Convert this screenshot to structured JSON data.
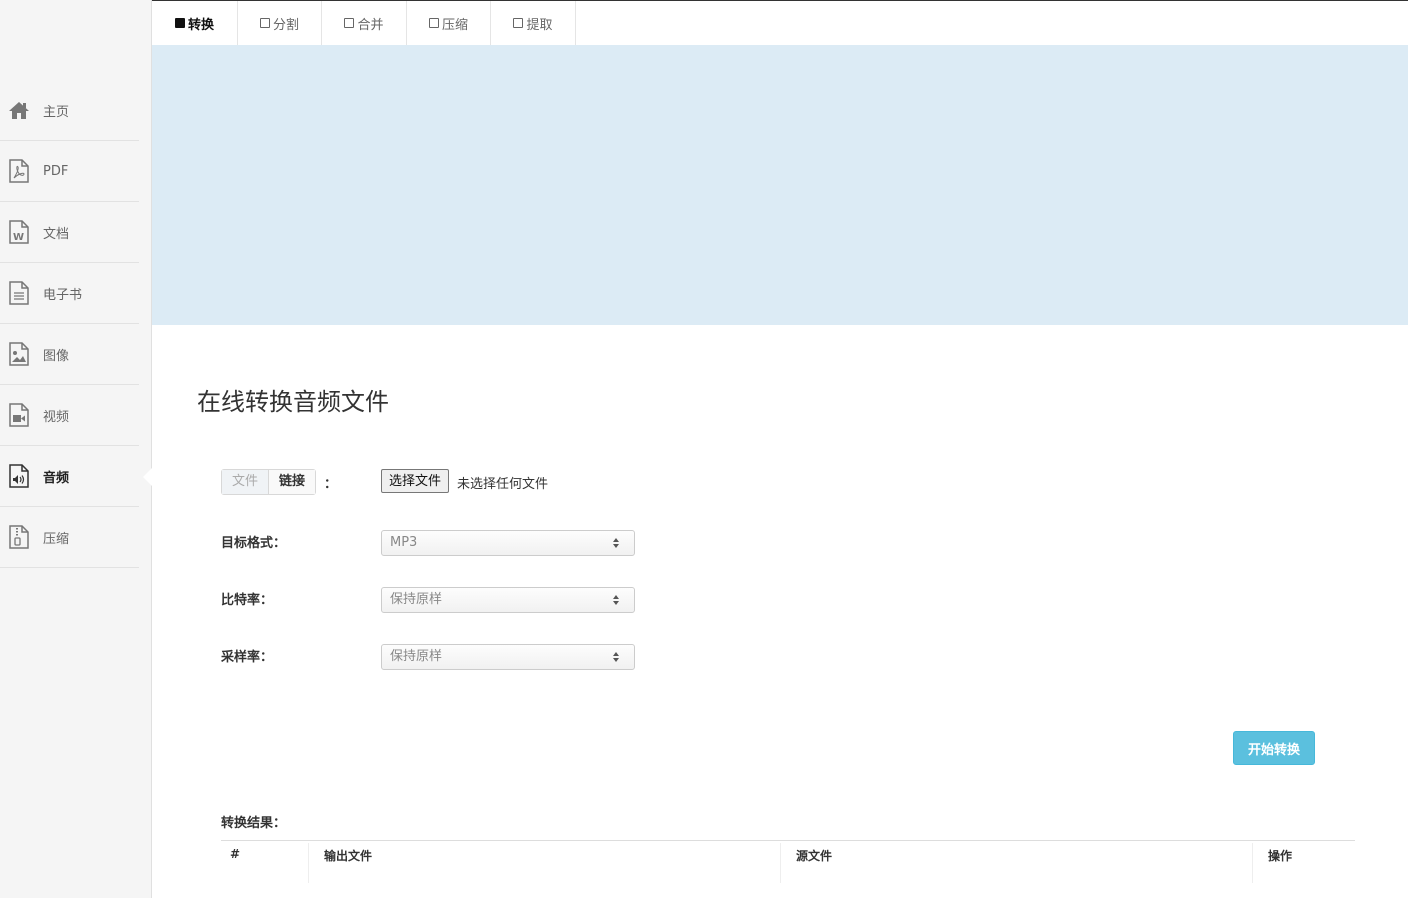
{
  "sidebar": {
    "items": [
      {
        "label": "主页",
        "icon": "home-icon",
        "active": false
      },
      {
        "label": "PDF",
        "icon": "pdf-file-icon",
        "active": false
      },
      {
        "label": "文档",
        "icon": "word-file-icon",
        "active": false
      },
      {
        "label": "电子书",
        "icon": "ebook-file-icon",
        "active": false
      },
      {
        "label": "图像",
        "icon": "image-file-icon",
        "active": false
      },
      {
        "label": "视频",
        "icon": "video-file-icon",
        "active": false
      },
      {
        "label": "音频",
        "icon": "audio-file-icon",
        "active": true
      },
      {
        "label": "压缩",
        "icon": "zip-file-icon",
        "active": false
      }
    ]
  },
  "tabs": [
    {
      "label": "转换",
      "active": true
    },
    {
      "label": "分割",
      "active": false
    },
    {
      "label": "合并",
      "active": false
    },
    {
      "label": "压缩",
      "active": false
    },
    {
      "label": "提取",
      "active": false
    }
  ],
  "main": {
    "title": "在线转换音频文件",
    "source_toggle": {
      "file": "文件",
      "link": "链接",
      "colon": "：",
      "selected": "链接"
    },
    "file_input": {
      "button": "选择文件",
      "status": "未选择任何文件"
    },
    "fields": {
      "format_label": "目标格式：",
      "format_value": "MP3",
      "bitrate_label": "比特率：",
      "bitrate_value": "保持原样",
      "samplerate_label": "采样率：",
      "samplerate_value": "保持原样"
    },
    "start_button": "开始转换",
    "results": {
      "label": "转换结果：",
      "columns": [
        "#",
        "输出文件",
        "源文件",
        "操作"
      ]
    }
  },
  "colors": {
    "banner": "#dcebf5",
    "accent": "#5bc0de",
    "sidebar": "#f5f5f5"
  }
}
